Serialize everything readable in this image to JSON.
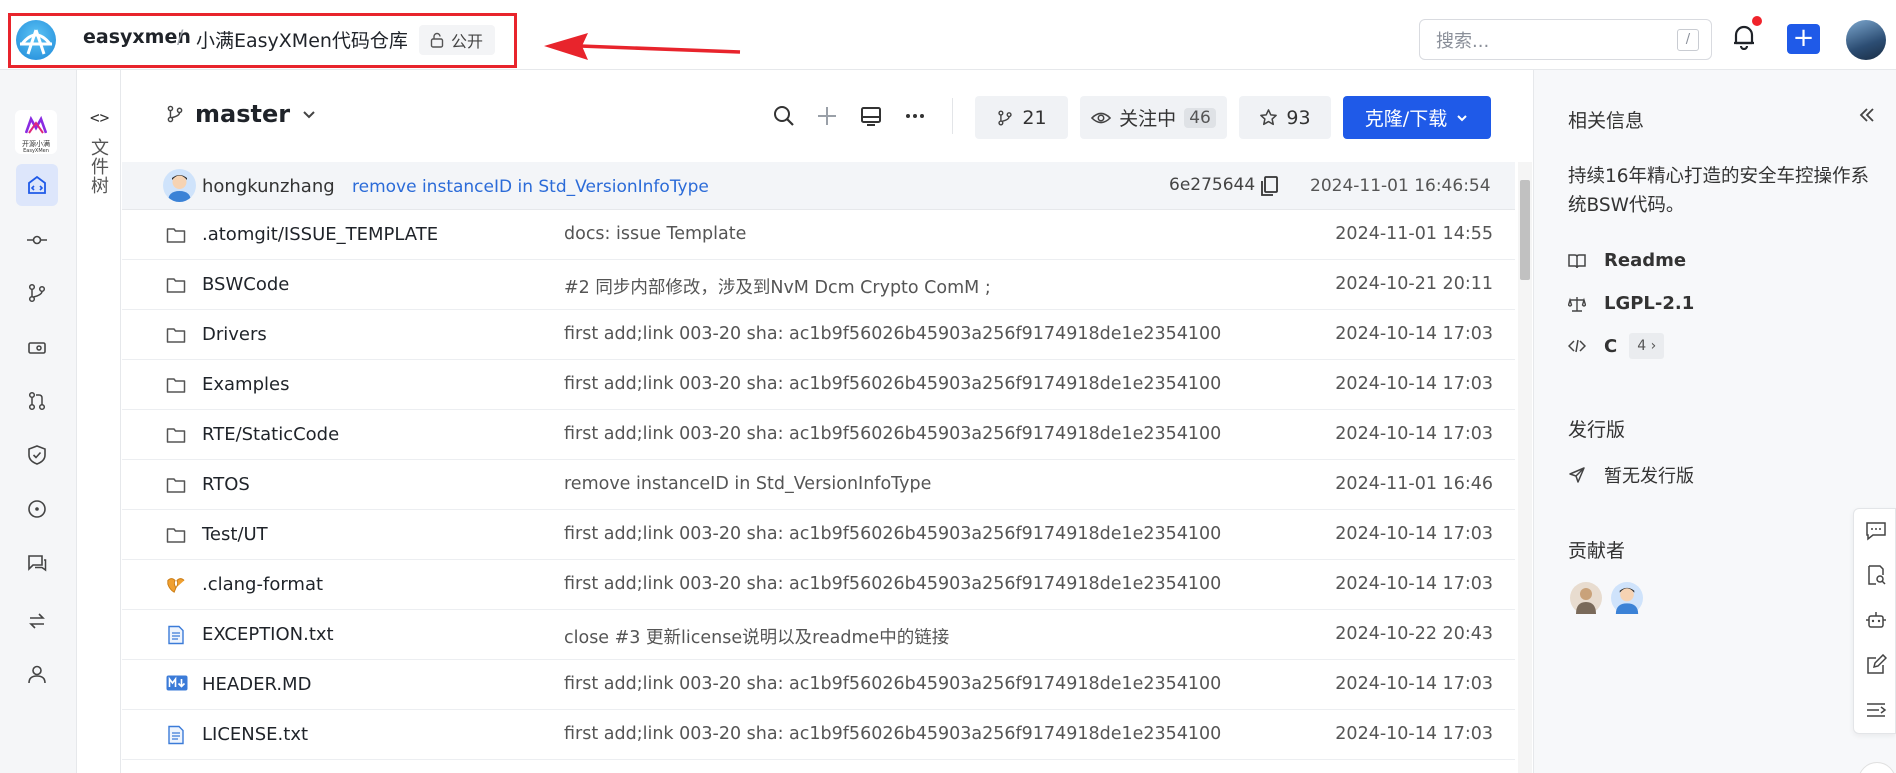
{
  "header": {
    "owner": "easyxmen",
    "separator": "/",
    "repo": "小满EasyXMen代码仓库",
    "visibility": "公开",
    "search_placeholder": "搜索...",
    "search_shortcut": "/"
  },
  "rail": {
    "logo_line1": "开源小满",
    "logo_line2": "EasyXMen"
  },
  "tree": {
    "toggle": "<>",
    "label": "文件树"
  },
  "toolbar": {
    "branch": "master",
    "forks": "21",
    "watch_label": "关注中",
    "watch_count": "46",
    "stars": "93",
    "clone_label": "克隆/下载"
  },
  "latest_commit": {
    "author": "hongkunzhang",
    "message": "remove instanceID in Std_VersionInfoType",
    "sha": "6e275644",
    "time": "2024-11-01 16:46:54"
  },
  "files": [
    {
      "type": "folder",
      "name": ".atomgit/ISSUE_TEMPLATE",
      "message": "docs: issue Template",
      "time": "2024-11-01 14:55"
    },
    {
      "type": "folder",
      "name": "BSWCode",
      "message": "#2 同步内部修改，涉及到NvM Dcm Crypto ComM ;",
      "time": "2024-10-21 20:11"
    },
    {
      "type": "folder",
      "name": "Drivers",
      "message": "first add;link 003-20 sha: ac1b9f56026b45903a256f9174918de1e2354100",
      "time": "2024-10-14 17:03"
    },
    {
      "type": "folder",
      "name": "Examples",
      "message": "first add;link 003-20 sha: ac1b9f56026b45903a256f9174918de1e2354100",
      "time": "2024-10-14 17:03"
    },
    {
      "type": "folder",
      "name": "RTE/StaticCode",
      "message": "first add;link 003-20 sha: ac1b9f56026b45903a256f9174918de1e2354100",
      "time": "2024-10-14 17:03"
    },
    {
      "type": "folder",
      "name": "RTOS",
      "message": "remove instanceID in Std_VersionInfoType",
      "time": "2024-11-01 16:46"
    },
    {
      "type": "folder",
      "name": "Test/UT",
      "message": "first add;link 003-20 sha: ac1b9f56026b45903a256f9174918de1e2354100",
      "time": "2024-10-14 17:03"
    },
    {
      "type": "clang",
      "name": ".clang-format",
      "message": "first add;link 003-20 sha: ac1b9f56026b45903a256f9174918de1e2354100",
      "time": "2024-10-14 17:03"
    },
    {
      "type": "text",
      "name": "EXCEPTION.txt",
      "message": "close #3 更新license说明以及readme中的链接",
      "time": "2024-10-22 20:43"
    },
    {
      "type": "markdown",
      "name": "HEADER.MD",
      "message": "first add;link 003-20 sha: ac1b9f56026b45903a256f9174918de1e2354100",
      "time": "2024-10-14 17:03"
    },
    {
      "type": "text",
      "name": "LICENSE.txt",
      "message": "first add;link 003-20 sha: ac1b9f56026b45903a256f9174918de1e2354100",
      "time": "2024-10-14 17:03"
    }
  ],
  "panel": {
    "title": "相关信息",
    "collapse": "〈〈",
    "description": "持续16年精心打造的安全车控操作系统BSW代码。",
    "readme": "Readme",
    "license": "LGPL-2.1",
    "language": "C",
    "language_count": "4 ›",
    "releases_title": "发行版",
    "releases_empty": "暂无发行版",
    "contributors_title": "贡献者"
  },
  "colors": {
    "primary": "#1f5ae8",
    "link": "#2b6bd8",
    "annotation_red": "#e8242c"
  }
}
